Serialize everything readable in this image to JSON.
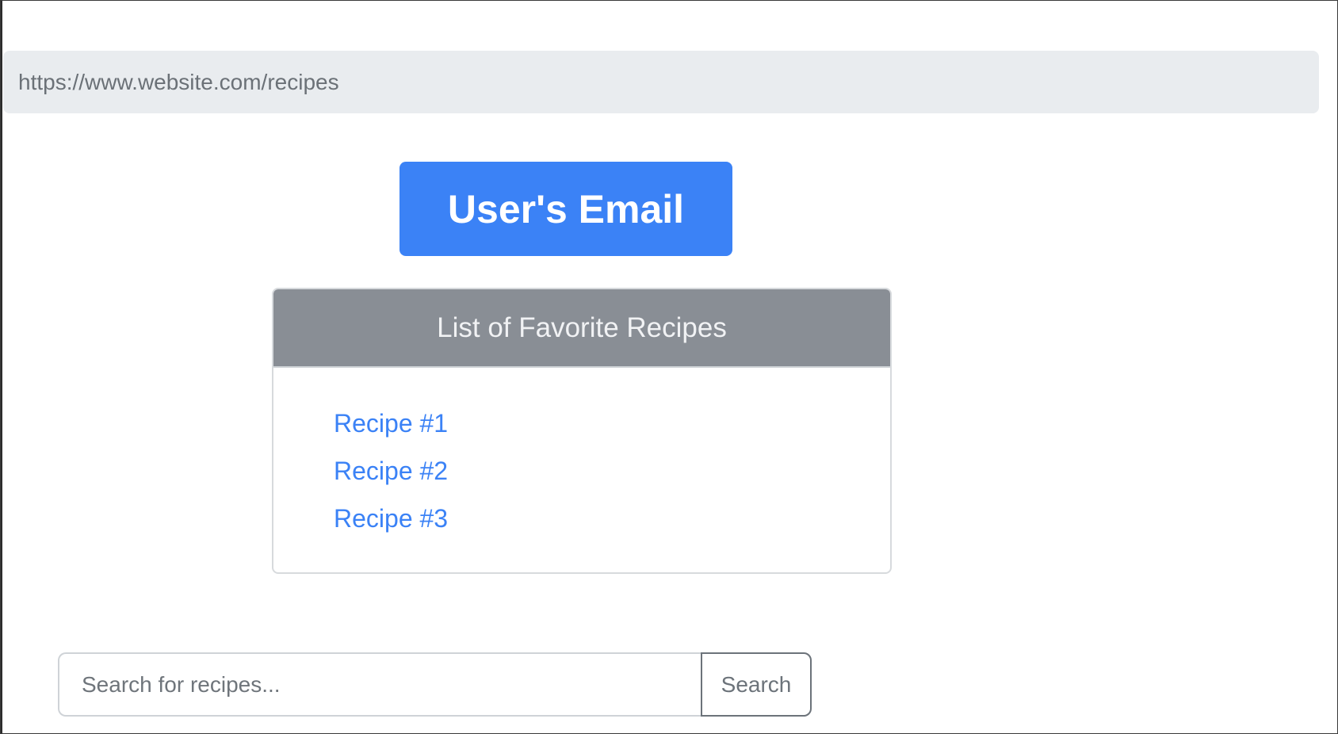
{
  "address_bar": {
    "url": "https://www.website.com/recipes"
  },
  "user_button": {
    "label": "User's Email"
  },
  "favorites": {
    "title": "List of Favorite Recipes",
    "items": [
      {
        "label": "Recipe #1"
      },
      {
        "label": "Recipe #2"
      },
      {
        "label": "Recipe #3"
      }
    ]
  },
  "search": {
    "placeholder": "Search for recipes...",
    "value": "",
    "button_label": "Search"
  },
  "colors": {
    "accent": "#3b82f6",
    "card_header": "#898e95",
    "url_bar": "#e9ecef"
  }
}
